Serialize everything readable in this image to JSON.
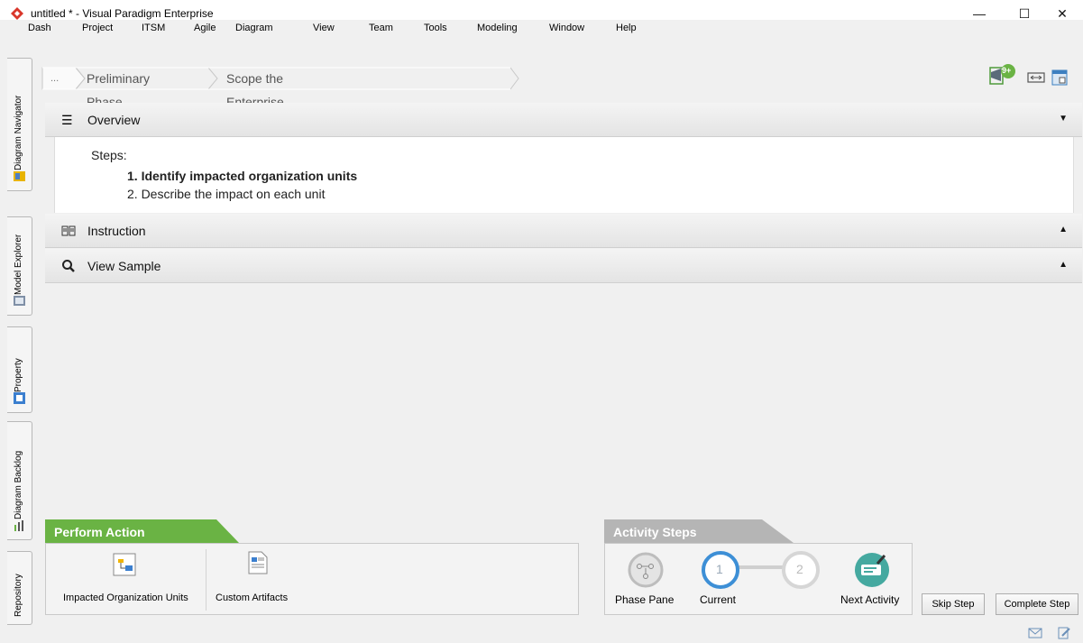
{
  "window": {
    "title": "untitled * - Visual Paradigm Enterprise",
    "controls": {
      "minimize": "—",
      "maximize": "☐",
      "close": "✕"
    }
  },
  "menu": [
    "Dash",
    "Project",
    "ITSM",
    "Agile",
    "Diagram",
    "View",
    "Team",
    "Tools",
    "Modeling",
    "Window",
    "Help"
  ],
  "left_tabs": [
    "Diagram Navigator",
    "Model Explorer",
    "Property",
    "Diagram Backlog",
    "Repository"
  ],
  "breadcrumb": {
    "ellipsis": "...",
    "items": [
      "Preliminary Phase",
      "Scope the Enterprise Organizations Impacted"
    ]
  },
  "toolbar": {
    "badge": "9+"
  },
  "overview": {
    "label": "Overview",
    "steps_title": "Steps:",
    "steps": [
      "1. Identify impacted organization units",
      "2. Describe the impact on each unit"
    ]
  },
  "instruction": {
    "label": "Instruction"
  },
  "view_sample": {
    "label": "View Sample"
  },
  "perform_action": {
    "title": "Perform Action",
    "actions": [
      "Impacted Organization Units",
      "Custom Artifacts"
    ]
  },
  "activity_steps": {
    "title": "Activity Steps",
    "phase_pane": "Phase Pane",
    "current_step": "1",
    "current_label": "Current",
    "next_step": "2",
    "next_activity": "Next Activity"
  },
  "buttons": {
    "skip": "Skip Step",
    "complete": "Complete Step"
  },
  "colors": {
    "accent_green": "#6ab344",
    "activity_gray": "#b5b5b5",
    "step_blue": "#3d8fd6",
    "brand_red": "#d9372b"
  }
}
